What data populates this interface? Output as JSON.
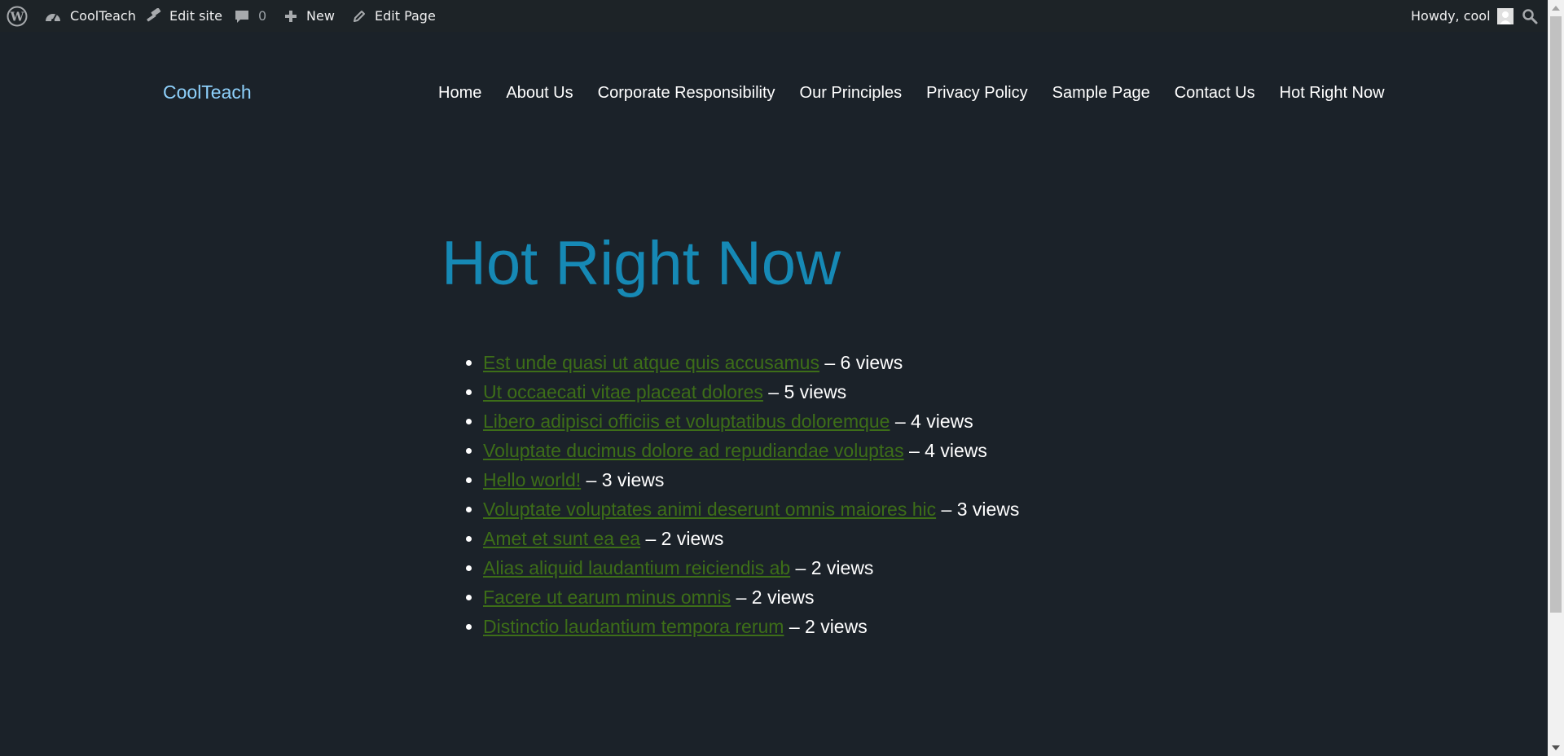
{
  "admin_bar": {
    "site_name": "CoolTeach",
    "edit_site": "Edit site",
    "comments_count": "0",
    "new_label": "New",
    "edit_page": "Edit Page",
    "howdy": "Howdy, cool"
  },
  "site": {
    "title": "CoolTeach"
  },
  "nav": {
    "items": [
      {
        "label": "Home"
      },
      {
        "label": "About Us"
      },
      {
        "label": "Corporate Responsibility"
      },
      {
        "label": "Our Principles"
      },
      {
        "label": "Privacy Policy"
      },
      {
        "label": "Sample Page"
      },
      {
        "label": "Contact Us"
      },
      {
        "label": "Hot Right Now"
      }
    ]
  },
  "page": {
    "title": "Hot Right Now"
  },
  "posts": [
    {
      "title": "Est unde quasi ut atque quis accusamus",
      "views": " – 6 views"
    },
    {
      "title": "Ut occaecati vitae placeat dolores",
      "views": " – 5 views"
    },
    {
      "title": "Libero adipisci officiis et voluptatibus doloremque",
      "views": " – 4 views"
    },
    {
      "title": "Voluptate ducimus dolore ad repudiandae voluptas",
      "views": " – 4 views"
    },
    {
      "title": "Hello world!",
      "views": " – 3 views"
    },
    {
      "title": "Voluptate voluptates animi deserunt omnis maiores hic",
      "views": " – 3 views"
    },
    {
      "title": "Amet et sunt ea ea",
      "views": " – 2 views"
    },
    {
      "title": "Alias aliquid laudantium reiciendis ab",
      "views": " – 2 views"
    },
    {
      "title": "Facere ut earum minus omnis",
      "views": " – 2 views"
    },
    {
      "title": "Distinctio laudantium tempora rerum",
      "views": " – 2 views"
    }
  ],
  "colors": {
    "background": "#1b2229",
    "admin_bar": "#1d2327",
    "site_title": "#8ed1fc",
    "page_title": "#1689b5",
    "post_link": "#3d6e18",
    "text": "#ffffff"
  },
  "icons": {
    "wordpress": "wordpress-logo-icon",
    "dashboard": "dashboard-gauge-icon",
    "edit_site": "hammer-icon",
    "comments": "speech-bubble-icon",
    "new": "plus-icon",
    "edit_page": "pencil-icon",
    "avatar": "user-avatar-icon",
    "search": "search-icon"
  }
}
